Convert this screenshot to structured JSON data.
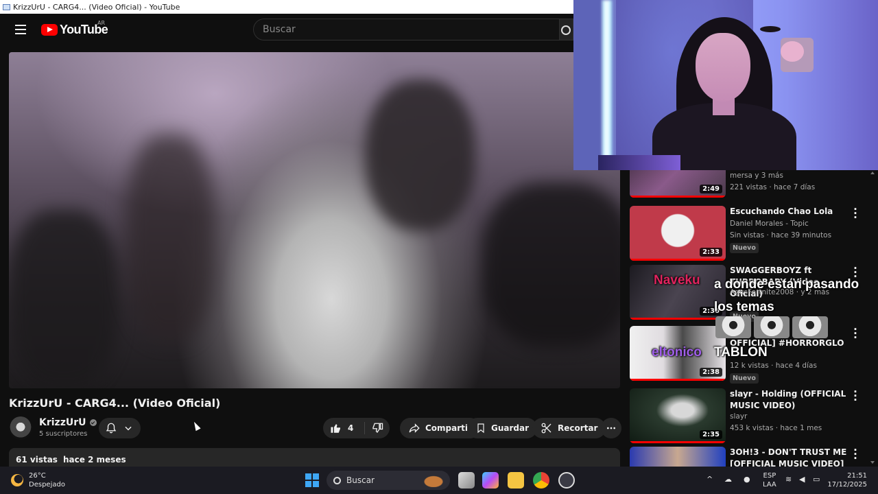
{
  "window": {
    "title": "KrizzUrU - CARG4... (Video Oficial) - YouTube"
  },
  "header": {
    "logo_text": "YouTube",
    "country_code": "AR",
    "search_placeholder": "Buscar"
  },
  "video": {
    "title": "KrizzUrU - CARG4... (Video Oficial)",
    "channel_name": "KrizzUrU",
    "subscribers": "5 suscriptores",
    "likes": "4",
    "share_label": "Compartir",
    "save_label": "Guardar",
    "clip_label": "Recortar",
    "views": "61 vistas",
    "published": "hace 2 meses"
  },
  "recommendations": [
    {
      "title": "",
      "channel": "mersa y 3 más",
      "meta": "221 vistas · hace 7 días",
      "duration": "2:49",
      "badge": "",
      "thumb_color": "#7a4a7a"
    },
    {
      "title": "Escuchando Chao Lola",
      "channel": "Daniel Morales - Topic",
      "meta": "Sin vistas · hace 39 minutos",
      "duration": "2:33",
      "badge": "Nuevo",
      "thumb_color": "#c03a4a"
    },
    {
      "title": "SWAGGERBOYZ ft TURROBABY (Video Oficial)",
      "channel": "AgusFortnite2008 · y 2 más",
      "meta": "",
      "duration": "2:36",
      "badge": "Nuevo",
      "thumb_color": "#3a3440"
    },
    {
      "title": "OFFICIAL] #HORRORGLO",
      "channel": "",
      "meta": "12 k vistas · hace 4 días",
      "duration": "2:38",
      "badge": "Nuevo",
      "thumb_color": "#e8e4e8"
    },
    {
      "title": "slayr - Holding (OFFICIAL MUSIC VIDEO)",
      "channel": "slayr",
      "meta": "453 k vistas · hace 1 mes",
      "duration": "2:35",
      "badge": "",
      "thumb_color": "#1e3a2a"
    },
    {
      "title": "3OH!3 - DON'T TRUST ME [OFFICIAL MUSIC VIDEO]",
      "channel": "",
      "meta": "",
      "duration": "",
      "badge": "",
      "thumb_color": "#2a3ab0"
    }
  ],
  "stream_chat": [
    {
      "user": "Naveku",
      "message": "a donde estan pasando los temas"
    },
    {
      "user": "eltonico",
      "message": "TABLON"
    }
  ],
  "taskbar": {
    "temperature": "26°C",
    "weather": "Despejado",
    "search_label": "Buscar",
    "lang_top": "ESP",
    "lang_bottom": "LAA",
    "time": "21:51",
    "date": "17/12/2025"
  },
  "colors": {
    "youtube_red": "#ff0000",
    "background": "#0f0f0f",
    "chip": "#272727",
    "chat_user_1": "#e0245e",
    "chat_user_2": "#9f5ee8"
  },
  "icons": {
    "menu": "hamburger-icon",
    "bell": "bell-icon",
    "like": "thumbs-up-icon",
    "dislike": "thumbs-down-icon",
    "share": "share-icon",
    "save": "bookmark-icon",
    "clip": "scissors-icon",
    "more": "more-horizontal-icon"
  }
}
